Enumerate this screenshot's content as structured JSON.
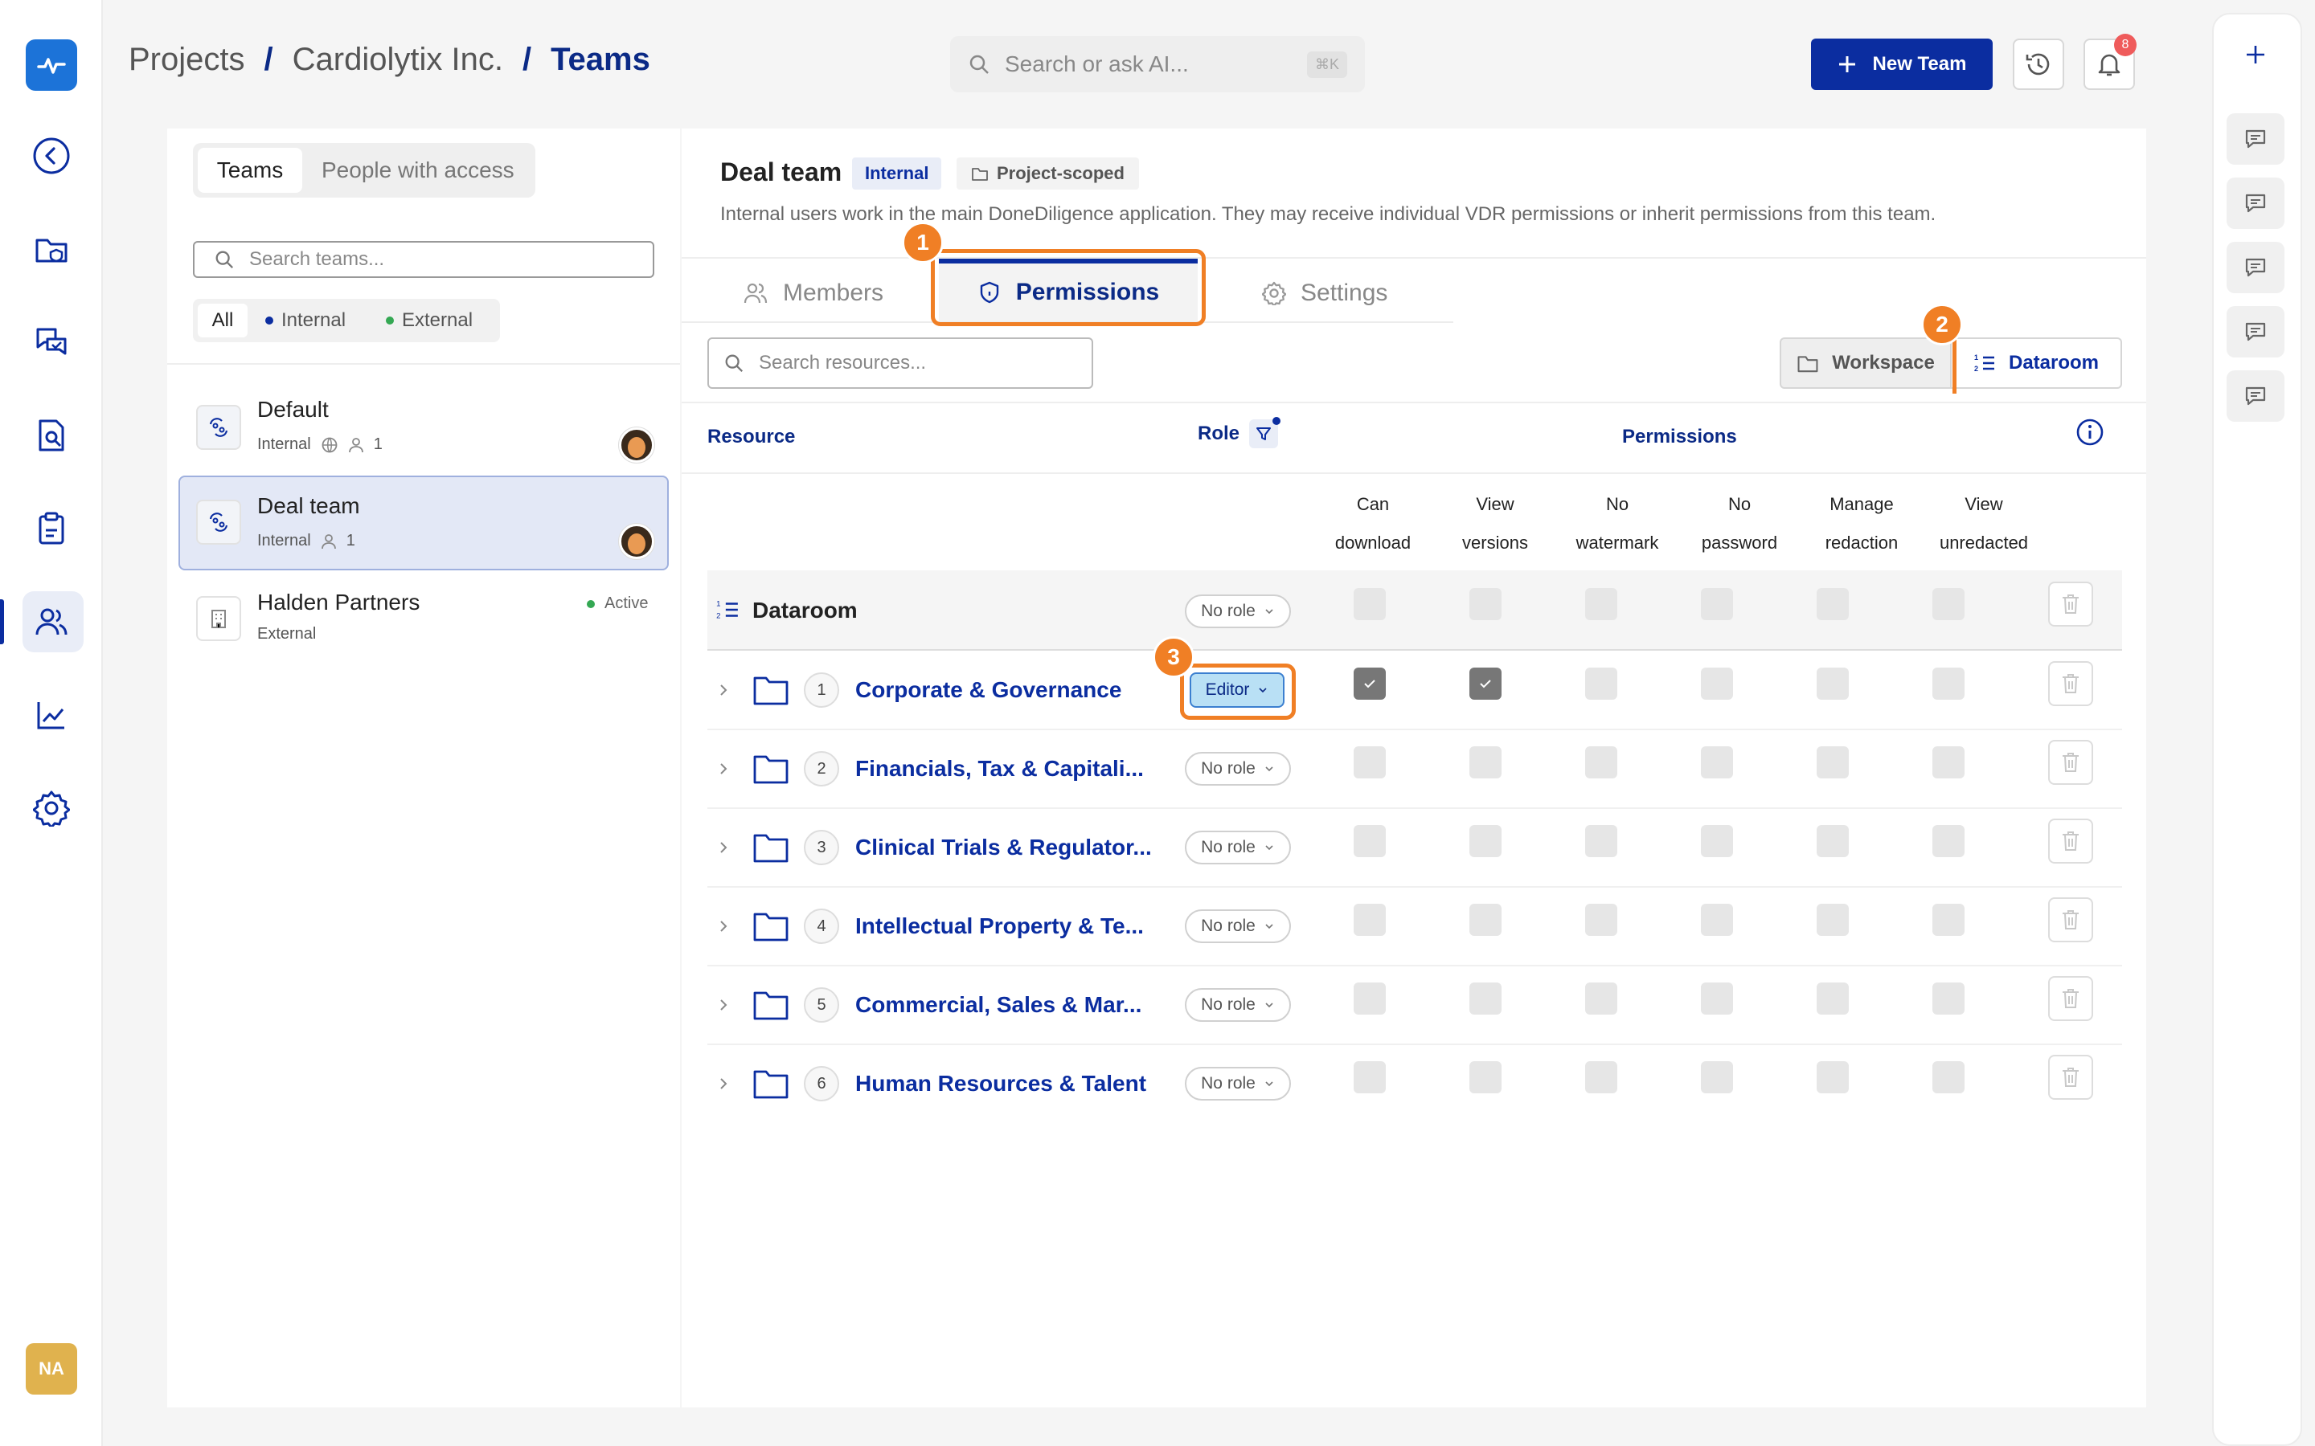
{
  "brand": {
    "accent": "#0b2da0",
    "highlight": "#f07f25",
    "logo_color": "#1c73d8"
  },
  "breadcrumb": {
    "items": [
      "Projects",
      "Cardiolytix Inc.",
      "Teams"
    ],
    "separator": "/"
  },
  "search": {
    "placeholder": "Search or ask AI...",
    "shortcut": "⌘K"
  },
  "header": {
    "new_team_label": "New Team",
    "notification_count": "8"
  },
  "sidebar": {
    "icons": [
      "back-icon",
      "folder-shield-icon",
      "chat-check-icon",
      "document-search-icon",
      "clipboard-icon",
      "users-icon",
      "chart-line-icon",
      "gear-icon"
    ],
    "active": "users-icon",
    "user_initials": "NA"
  },
  "teams_panel": {
    "tabs": [
      "Teams",
      "People with access"
    ],
    "search_placeholder": "Search teams...",
    "filters": [
      "All",
      "Internal",
      "External"
    ],
    "items": [
      {
        "name": "Default",
        "type": "Internal",
        "members": "1"
      },
      {
        "name": "Deal team",
        "type": "Internal",
        "members": "1"
      },
      {
        "name": "Halden Partners",
        "type": "External",
        "status": "Active"
      }
    ]
  },
  "team_detail": {
    "title": "Deal team",
    "tag_internal": "Internal",
    "tag_scope": "Project-scoped",
    "description": "Internal users work in the main DoneDiligence application. They may receive individual VDR permissions or inherit permissions from this team.",
    "tabs": [
      "Members",
      "Permissions",
      "Settings"
    ],
    "active_tab": "Permissions",
    "resource_search_placeholder": "Search resources...",
    "scope_buttons": [
      "Workspace",
      "Dataroom"
    ],
    "active_scope": "Dataroom",
    "callouts": [
      "1",
      "2",
      "3"
    ]
  },
  "permissions_table": {
    "headers": {
      "resource": "Resource",
      "role": "Role",
      "permissions": "Permissions"
    },
    "permission_columns": [
      [
        "Can",
        "download"
      ],
      [
        "View",
        "versions"
      ],
      [
        "No",
        "watermark"
      ],
      [
        "No",
        "password"
      ],
      [
        "Manage",
        "redaction"
      ],
      [
        "View",
        "unredacted"
      ]
    ],
    "dataroom_row": {
      "name": "Dataroom",
      "role": "No role",
      "checks": [
        false,
        false,
        false,
        false,
        false,
        false
      ]
    },
    "rows": [
      {
        "index": "1",
        "name": "Corporate & Governance",
        "role": "Editor",
        "checks": [
          true,
          true,
          false,
          false,
          false,
          false
        ]
      },
      {
        "index": "2",
        "name": "Financials, Tax & Capitali...",
        "role": "No role",
        "checks": [
          false,
          false,
          false,
          false,
          false,
          false
        ]
      },
      {
        "index": "3",
        "name": "Clinical Trials & Regulator...",
        "role": "No role",
        "checks": [
          false,
          false,
          false,
          false,
          false,
          false
        ]
      },
      {
        "index": "4",
        "name": "Intellectual Property & Te...",
        "role": "No role",
        "checks": [
          false,
          false,
          false,
          false,
          false,
          false
        ]
      },
      {
        "index": "5",
        "name": "Commercial, Sales & Mar...",
        "role": "No role",
        "checks": [
          false,
          false,
          false,
          false,
          false,
          false
        ]
      },
      {
        "index": "6",
        "name": "Human Resources & Talent",
        "role": "No role",
        "checks": [
          false,
          false,
          false,
          false,
          false,
          false
        ]
      }
    ]
  }
}
